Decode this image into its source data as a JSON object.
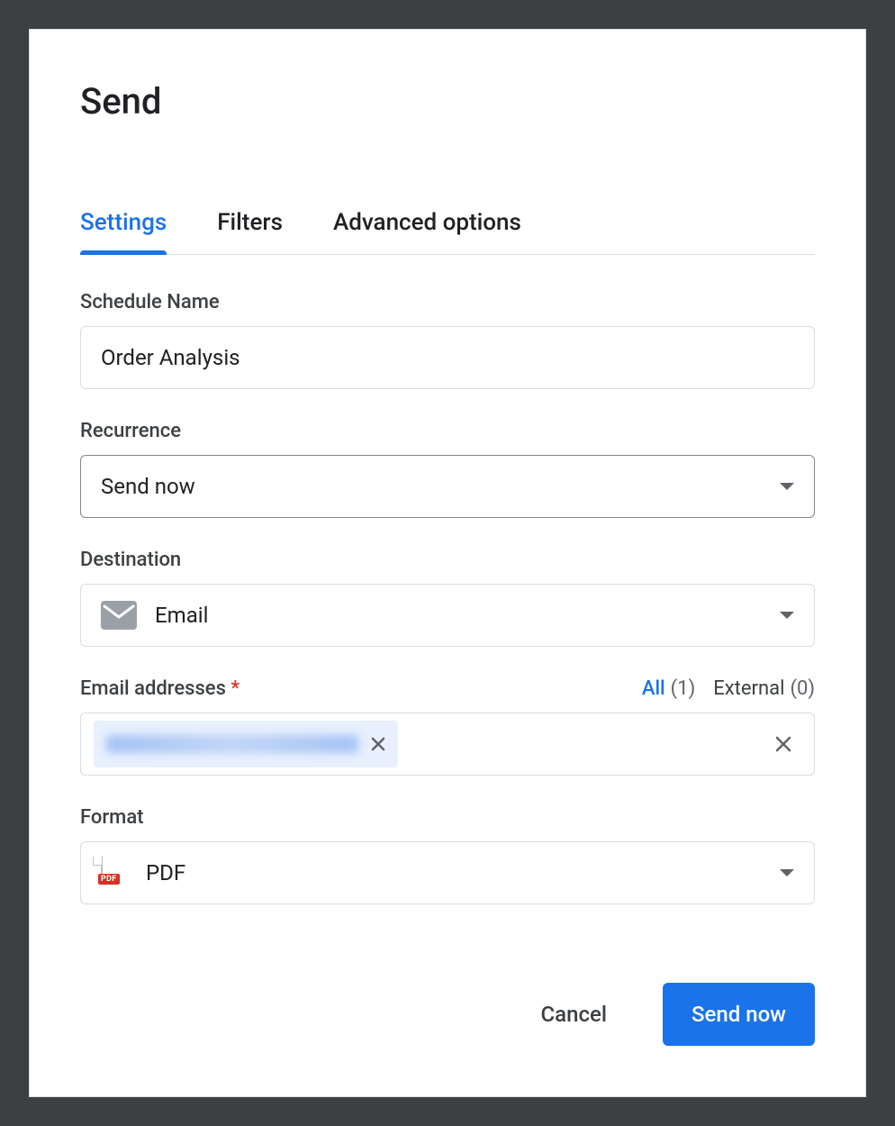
{
  "dialog": {
    "title": "Send"
  },
  "tabs": {
    "settings": "Settings",
    "filters": "Filters",
    "advanced": "Advanced options"
  },
  "form": {
    "schedule_name": {
      "label": "Schedule Name",
      "value": "Order Analysis"
    },
    "recurrence": {
      "label": "Recurrence",
      "value": "Send now"
    },
    "destination": {
      "label": "Destination",
      "value": "Email"
    },
    "email_addresses": {
      "label": "Email addresses",
      "required": "*",
      "filters": {
        "all": {
          "name": "All",
          "count": "(1)"
        },
        "external": {
          "name": "External",
          "count": "(0)"
        }
      }
    },
    "format": {
      "label": "Format",
      "value": "PDF",
      "badge": "PDF"
    }
  },
  "footer": {
    "cancel": "Cancel",
    "submit": "Send now"
  }
}
